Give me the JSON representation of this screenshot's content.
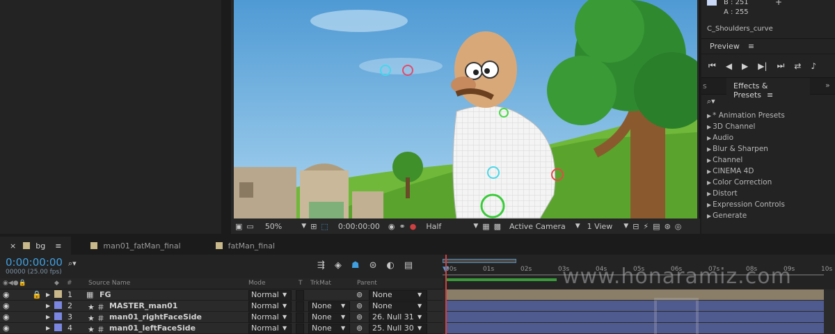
{
  "top_right_info": {
    "b_value": "B : 251",
    "a_value": "A : 255",
    "layer_name": "C_Shoulders_curve"
  },
  "preview": {
    "title": "Preview"
  },
  "effects": {
    "tab_left": "s",
    "title": "Effects & Presets",
    "items": [
      "* Animation Presets",
      "3D Channel",
      "Audio",
      "Blur & Sharpen",
      "Channel",
      "CINEMA 4D",
      "Color Correction",
      "Distort",
      "Expression Controls",
      "Generate"
    ]
  },
  "viewer": {
    "zoom": "50%",
    "timecode": "0:00:00:00",
    "resolution": "Half",
    "camera": "Active Camera",
    "view": "1 View"
  },
  "timeline": {
    "tabs": [
      {
        "label": "bg",
        "color": "#c8b88a"
      },
      {
        "label": "man01_fatMan_final",
        "color": "#c8b88a"
      },
      {
        "label": "fatMan_final",
        "color": "#c8b88a"
      }
    ],
    "timecode": "0:00:00:00",
    "fps": "00000 (25.00 fps)",
    "columns": {
      "num": "#",
      "source": "Source Name",
      "mode": "Mode",
      "t": "T",
      "trkmat": "TrkMat",
      "parent": "Parent"
    },
    "ruler": [
      "00s",
      "01s",
      "02s",
      "03s",
      "04s",
      "05s",
      "06s",
      "07s",
      "08s",
      "09s",
      "10s"
    ],
    "layers": [
      {
        "num": "1",
        "name": "FG",
        "mode": "Normal",
        "trkmat": "",
        "parent": "None",
        "label_color": "#c8b88a",
        "locked": true
      },
      {
        "num": "2",
        "name": "MASTER_man01",
        "mode": "Normal",
        "trkmat": "None",
        "parent": "None",
        "label_color": "#7a86e0",
        "locked": false
      },
      {
        "num": "3",
        "name": "man01_rightFaceSide",
        "mode": "Normal",
        "trkmat": "None",
        "parent": "26. Null 31",
        "label_color": "#7a86e0",
        "locked": false
      },
      {
        "num": "4",
        "name": "man01_leftFaceSide",
        "mode": "Normal",
        "trkmat": "None",
        "parent": "25. Null 30",
        "label_color": "#7a86e0",
        "locked": false
      }
    ]
  },
  "watermark": "www.honaramiz.com"
}
